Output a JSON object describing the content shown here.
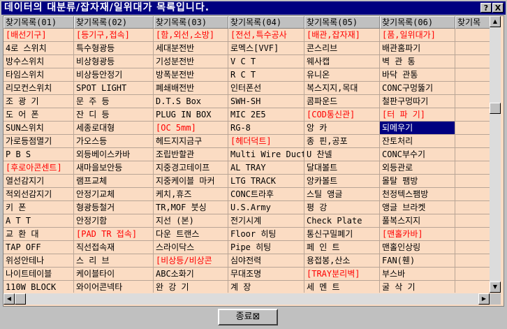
{
  "window": {
    "title": "데이터의 대분류/잡자재/일위대가 목록입니다.",
    "help_label": "?",
    "close_label": "X"
  },
  "columns": [
    "찾기목록(01)",
    "찾기목록(02)",
    "찾기목록(03)",
    "찾기목록(04)",
    "찾기목록(05)",
    "찾기목록(06)",
    "찾기목"
  ],
  "rows": [
    [
      "[배선기구]",
      "[등기구,접속]",
      "[함,외선,소방]",
      "[전선,특수공사",
      "[배관,잡자재]",
      "[품,일위대가]",
      ""
    ],
    [
      "4로 스위치",
      "특수형광등",
      "세대분전반",
      "로멕스[VVF]",
      "콘스리브",
      "배관홈파기",
      ""
    ],
    [
      "방수스위치",
      "비상형광등",
      "기성분전반",
      "V C T",
      "웨사캡",
      "벽 관 통",
      ""
    ],
    [
      "타임스위치",
      "비상등안정기",
      "방폭분전반",
      "R C T",
      "유니온",
      "바닥 관통",
      ""
    ],
    [
      "리모컨스위치",
      "SPOT LIGHT",
      "폐쇄배전반",
      "인터폰선",
      "복스지지,목대",
      "CONC구멍뚫기",
      ""
    ],
    [
      "조 광 기",
      "문 주 등",
      "D.T.S Box",
      "SWH-SH",
      "콤파운드",
      "철판구멍따기",
      ""
    ],
    [
      "도 어 폰",
      "잔 디 등",
      "PLUG IN BOX",
      "MIC 2E5",
      "[COD통신관]",
      "[터 파 기]",
      ""
    ],
    [
      "SUN스위치",
      "세종로대형",
      "[OC 5mm]",
      "RG-8",
      "앙   카",
      "되메우기",
      ""
    ],
    [
      "가로등점멸기",
      "가오스등",
      "헤드지지금구",
      "[헤더덕트]",
      "종 핀,공포",
      "잔토처리",
      ""
    ],
    [
      "P B S",
      "외등베이스카바",
      "조립반할관",
      "Multi Wire Duct",
      "U 찬넬",
      "CONC부수기",
      ""
    ],
    [
      "[후로아콘센트]",
      "새마을보안등",
      "지중경고테이프",
      "AL TRAY",
      "달대볼트",
      "외등관로",
      ""
    ],
    [
      "열선감지기",
      "램프교체",
      "지중케이블 마커",
      "LTG TRACK",
      "앙카볼트",
      "몰탈 팸방",
      ""
    ],
    [
      "적외선감지기",
      "안정기교체",
      "케치,휴즈",
      "CONC트라후",
      "스틸 앵글",
      "천정텍스팸방",
      ""
    ],
    [
      "키   폰",
      "형광등철거",
      "TR,MOF 붓싱",
      "U.S.Army",
      "평   강",
      "앵글 브라켓",
      ""
    ],
    [
      "A T T",
      "안정기함",
      "지선 (본)",
      "전기시계",
      "Check Plate",
      "풀복스지지",
      ""
    ],
    [
      "교 환 대",
      "[PAD TR 접속]",
      "다운 트랜스",
      "Floor 히팅",
      "통신구밀폐기",
      "[맨홀카바]",
      ""
    ],
    [
      "TAP OFF",
      "직선접속재",
      "스라이닥스",
      "Pipe 히팅",
      "페 인 트",
      "맨홀인상링",
      ""
    ],
    [
      "위성안테나",
      "스 리 브",
      "[비상등/비상콘",
      "심야전력",
      "용접봉,산소",
      "FAN(휀)",
      ""
    ],
    [
      "나이트테이블",
      "케이블타이",
      "ABC소화기",
      "무대조명",
      "[TRAY분리벽]",
      "부스바",
      ""
    ],
    [
      "110W BLOCK",
      "와이어콘넥타",
      "완 강 기",
      "계   장",
      "세 멘 트",
      "굴 삭 기",
      ""
    ]
  ],
  "category_cells": [
    [
      0,
      0
    ],
    [
      0,
      1
    ],
    [
      0,
      2
    ],
    [
      0,
      3
    ],
    [
      0,
      4
    ],
    [
      0,
      5
    ],
    [
      6,
      4
    ],
    [
      6,
      5
    ],
    [
      7,
      2
    ],
    [
      8,
      3
    ],
    [
      10,
      0
    ],
    [
      15,
      1
    ],
    [
      15,
      5
    ],
    [
      17,
      2
    ],
    [
      18,
      4
    ]
  ],
  "selected_cell": [
    7,
    5
  ],
  "footer": {
    "close_button_label": "종료⊠"
  },
  "colors": {
    "grid_bg": "#fbdcc3",
    "category_text": "#ff0000",
    "title_bg": "#000080",
    "selection_bg": "#000080"
  }
}
